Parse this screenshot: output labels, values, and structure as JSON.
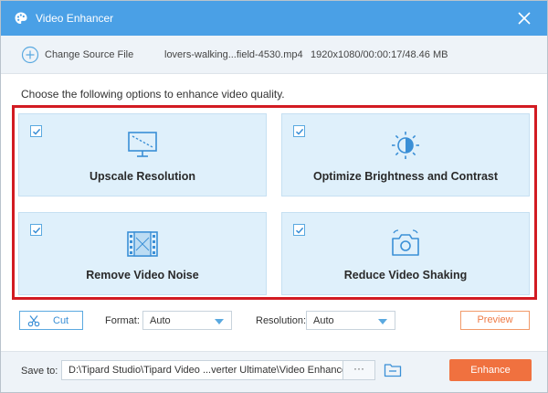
{
  "window": {
    "title": "Video Enhancer",
    "accent_color": "#4aa0e6",
    "icons": {
      "app": "palette-icon",
      "close": "close-icon"
    }
  },
  "source": {
    "change_label": "Change Source File",
    "filename": "lovers-walking...field-4530.mp4",
    "meta": "1920x1080/00:00:17/48.46 MB",
    "icon": "add-circle-icon"
  },
  "instruction": "Choose the following options to enhance video quality.",
  "options": [
    {
      "label": "Upscale Resolution",
      "checked": true,
      "icon": "upscale-icon"
    },
    {
      "label": "Optimize Brightness and Contrast",
      "checked": true,
      "icon": "brightness-icon"
    },
    {
      "label": "Remove Video Noise",
      "checked": true,
      "icon": "film-noise-icon"
    },
    {
      "label": "Reduce Video Shaking",
      "checked": true,
      "icon": "camera-shake-icon"
    }
  ],
  "toolbar": {
    "cut_label": "Cut",
    "format_label": "Format:",
    "format_value": "Auto",
    "resolution_label": "Resolution:",
    "resolution_value": "Auto",
    "preview_label": "Preview"
  },
  "footer": {
    "save_label": "Save to:",
    "path": "D:\\Tipard Studio\\Tipard Video ...verter Ultimate\\Video Enhancer",
    "browse_label": "···",
    "enhance_label": "Enhance",
    "enhance_color": "#f0713f"
  }
}
